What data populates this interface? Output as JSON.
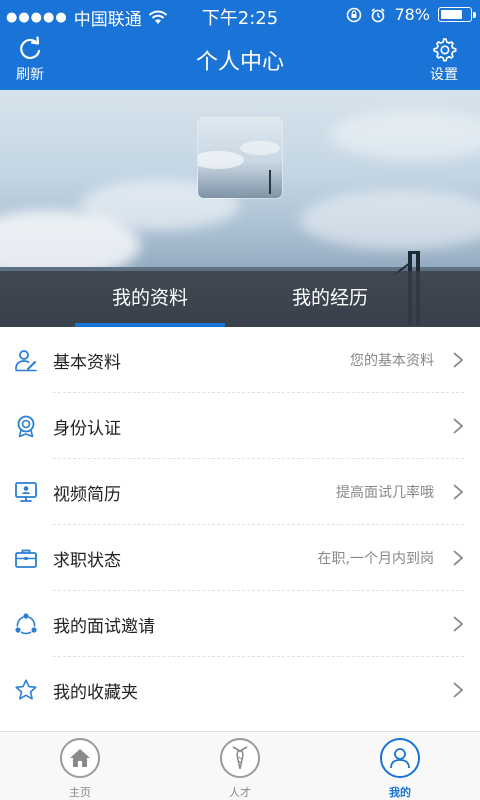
{
  "status_bar": {
    "carrier": "中国联通",
    "time": "下午2:25",
    "battery": "78%",
    "battery_level": 0.78
  },
  "header": {
    "title": "个人中心",
    "refresh_label": "刷新",
    "settings_label": "设置"
  },
  "tabs": [
    {
      "label": "我的资料",
      "active": true
    },
    {
      "label": "我的经历",
      "active": false
    }
  ],
  "menu": [
    {
      "label": "基本资料",
      "hint": "您的基本资料",
      "icon": "person-edit-icon"
    },
    {
      "label": "身份认证",
      "hint": "",
      "icon": "badge-icon"
    },
    {
      "label": "视频简历",
      "hint": "提高面试几率哦",
      "icon": "monitor-icon"
    },
    {
      "label": "求职状态",
      "hint": "在职,一个月内到岗",
      "icon": "briefcase-icon"
    },
    {
      "label": "我的面试邀请",
      "hint": "",
      "icon": "network-icon"
    },
    {
      "label": "我的收藏夹",
      "hint": "",
      "icon": "star-icon"
    }
  ],
  "bottom_nav": [
    {
      "label": "主页",
      "icon": "home-icon",
      "active": false
    },
    {
      "label": "人才",
      "icon": "tie-icon",
      "active": false
    },
    {
      "label": "我的",
      "icon": "user-icon",
      "active": true
    }
  ],
  "colors": {
    "primary": "#1a73d6",
    "icon_blue": "#2a7fd4"
  }
}
